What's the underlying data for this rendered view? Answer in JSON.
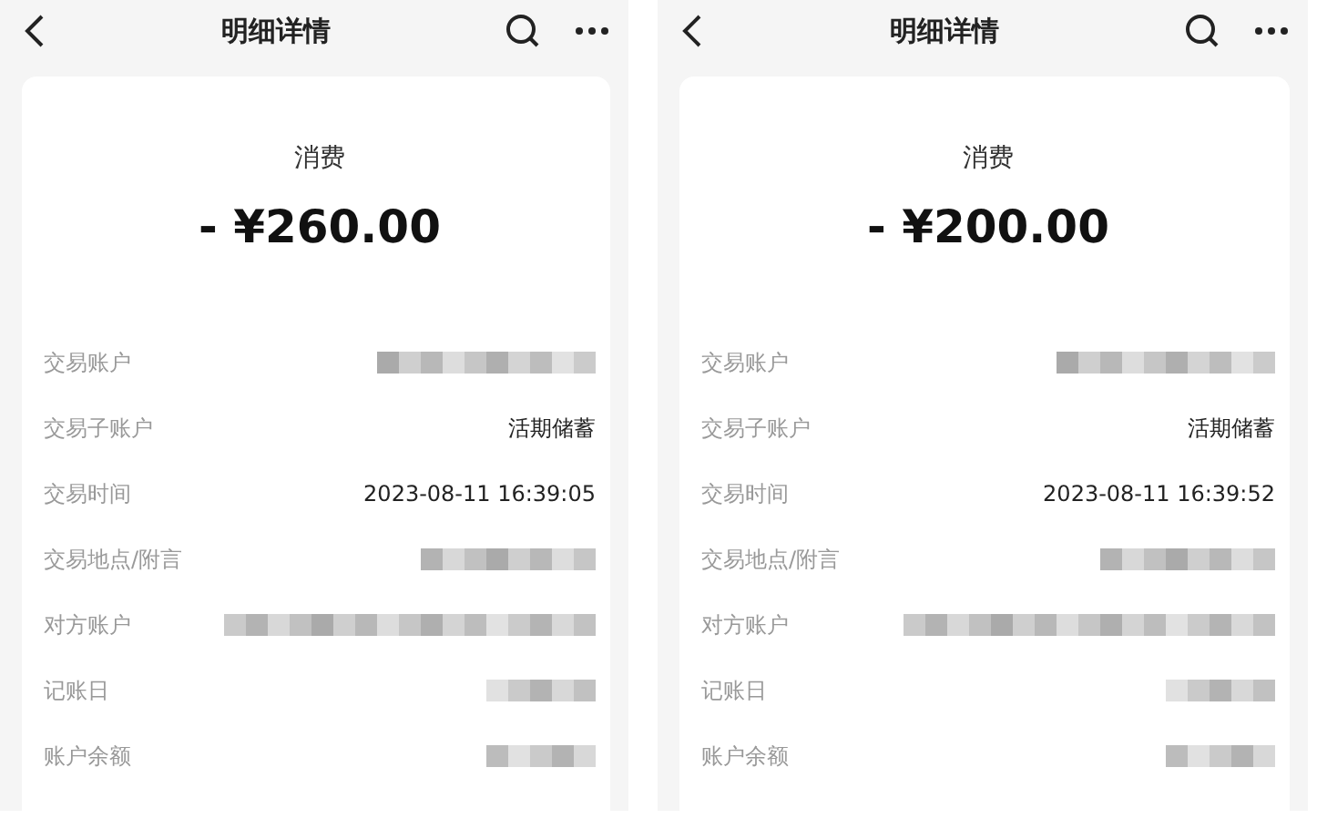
{
  "screens": [
    {
      "title": "明细详情",
      "category": "消费",
      "amount": "- ¥260.00",
      "rows": [
        {
          "label": "交易账户",
          "kind": "redacted"
        },
        {
          "label": "交易子账户",
          "kind": "text",
          "value": "活期储蓄"
        },
        {
          "label": "交易时间",
          "kind": "text",
          "value": "2023-08-11 16:39:05"
        },
        {
          "label": "交易地点/附言",
          "kind": "redacted"
        },
        {
          "label": "对方账户",
          "kind": "redacted"
        },
        {
          "label": "记账日",
          "kind": "redacted"
        },
        {
          "label": "账户余额",
          "kind": "redacted"
        }
      ]
    },
    {
      "title": "明细详情",
      "category": "消费",
      "amount": "- ¥200.00",
      "rows": [
        {
          "label": "交易账户",
          "kind": "redacted"
        },
        {
          "label": "交易子账户",
          "kind": "text",
          "value": "活期储蓄"
        },
        {
          "label": "交易时间",
          "kind": "text",
          "value": "2023-08-11 16:39:52"
        },
        {
          "label": "交易地点/附言",
          "kind": "redacted"
        },
        {
          "label": "对方账户",
          "kind": "redacted"
        },
        {
          "label": "记账日",
          "kind": "redacted"
        },
        {
          "label": "账户余额",
          "kind": "redacted"
        }
      ]
    }
  ]
}
